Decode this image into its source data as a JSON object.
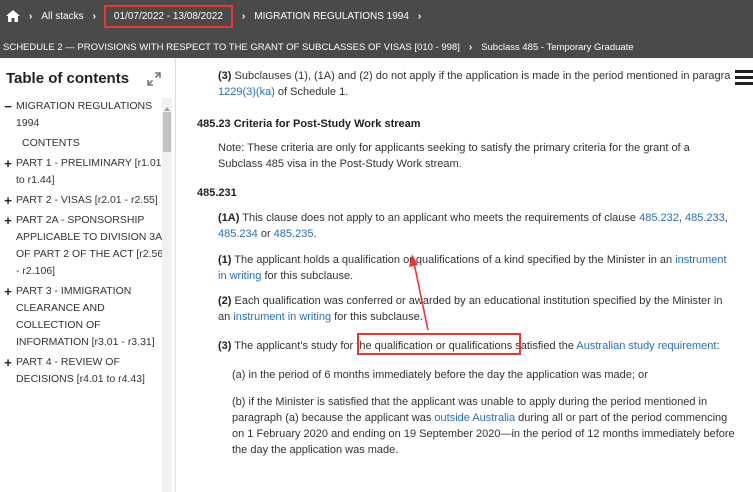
{
  "breadcrumb": {
    "home_icon": "home-icon",
    "row1": [
      "All stacks",
      "01/07/2022 - 13/08/2022",
      "MIGRATION REGULATIONS 1994"
    ],
    "row2": [
      "SCHEDULE 2 — PROVISIONS WITH RESPECT TO THE GRANT OF SUBCLASSES OF VISAS [010 - 998]",
      "Subclass 485 - Temporary Graduate"
    ]
  },
  "toc": {
    "title": "Table of contents",
    "items": [
      {
        "mark": "−",
        "label": "MIGRATION REGULATIONS 1994"
      },
      {
        "mark": "",
        "label": "CONTENTS"
      },
      {
        "mark": "+",
        "label": "PART 1 - PRELIMINARY [r1.01 to r1.44]"
      },
      {
        "mark": "+",
        "label": "PART 2 - VISAS [r2.01 - r2.55]"
      },
      {
        "mark": "+",
        "label": "PART 2A - SPONSORSHIP APPLICABLE TO DIVISION 3A OF PART 2 OF THE ACT [r2.56 - r2.106]"
      },
      {
        "mark": "+",
        "label": "PART 3 - IMMIGRATION CLEARANCE AND COLLECTION OF INFORMATION [r3.01 - r3.31]"
      },
      {
        "mark": "+",
        "label": "PART 4 - REVIEW OF DECISIONS [r4.01 to r4.43]"
      }
    ]
  },
  "content": {
    "p_sub3_num": "(3)",
    "p_sub3_text": " Subclauses (1), (1A) and (2) do not apply if the application is made in the period mentioned in paragra",
    "p_sub3_link": "1229(3)(ka)",
    "p_sub3_tail": " of Schedule 1.",
    "heading_48523": "485.23  Criteria for Post-Study Work stream",
    "note_line1": "Note:   These criteria are only for applicants seeking to satisfy the primary criteria for the grant of a",
    "note_line2": "Subclass 485 visa in the Post-Study Work stream.",
    "heading_485231": "485.231",
    "p1a_num": "(1A)",
    "p1a_text": "  This clause does not apply to an applicant who meets the requirements of clause ",
    "p1a_link1": "485.232",
    "p1a_link2": "485.233",
    "p1a_link3": "485.234",
    "p1a_or": " or ",
    "p1a_link4": "485.235",
    "p1_num": "(1)",
    "p1_text": "  The applicant holds a qualification or qualifications of a kind specified by the Minister in an ",
    "p1_link": "instrument in writing",
    "p1_link_a": "instrument",
    "p1_link_b": "in writing",
    "p1_tail": " for this subclause.",
    "p2_num": "(2)",
    "p2_text": "  Each qualification was conferred or awarded by an educational institution specified by the Minister in",
    "p2_an": "an ",
    "p2_link": "instrument in writing",
    "p2_tail": " for this subclause.",
    "p3_num": "(3)",
    "p3_text_a": "  The applicant's study for ",
    "p3_highlight": "the qualification or qualifications",
    "p3_text_b": " satisfied the ",
    "p3_link": "Australian study requirement",
    "p3_tail": ":",
    "pa": "(a) in the period of 6 months immediately before the day the application was made; or",
    "pb_line1": "(b) if the Minister is satisfied that the applicant was unable to apply during the period mentioned in",
    "pb_line2a": "paragraph (a) because the applicant was ",
    "pb_link": "outside Australia",
    "pb_line2b": " during all or part of the period commencing",
    "pb_line3": "on 1 February 2020 and ending on 19 September 2020—in the period of 12 months immediately before",
    "pb_line4": "the day the application was made."
  },
  "colors": {
    "topbar": "#4a4a4a",
    "link": "#2a6ebb",
    "highlight": "#e53935"
  }
}
